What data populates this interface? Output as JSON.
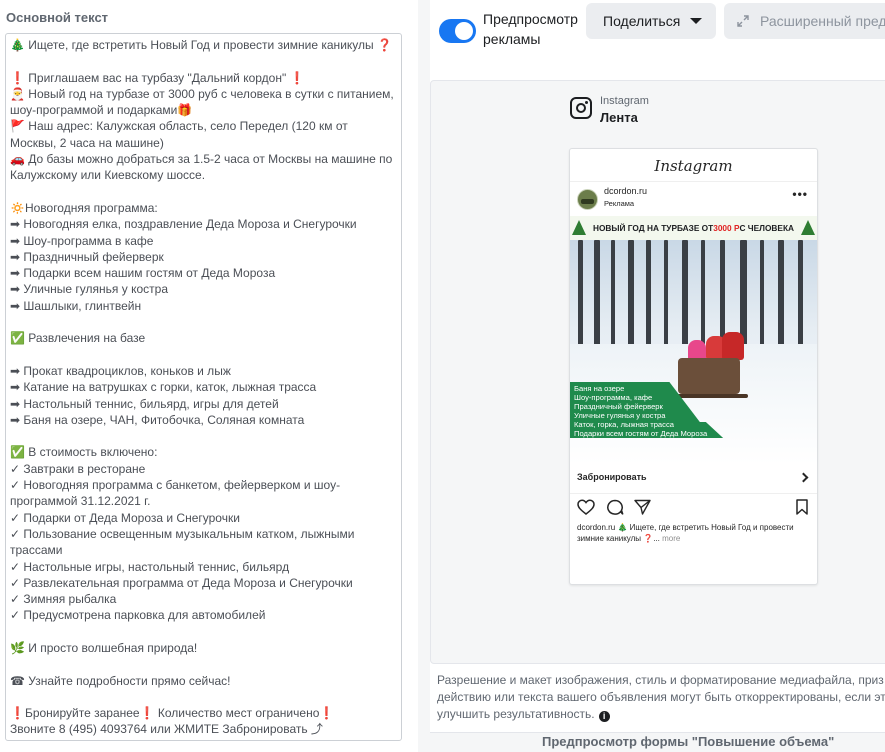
{
  "editor": {
    "title": "Основной текст",
    "body": "🎄 Ищете, где встретить Новый Год и провести зимние каникулы ❓\n\n❗ Приглашаем вас на турбазу \"Дальний кордон\" ❗\n🎅 Новый год на турбазе от 3000 руб с человека в сутки с питанием, шоу-программой и подарками🎁\n🚩 Наш адрес: Калужская область, село Передел (120 км от Москвы, 2 часа на машине)\n🚗 До базы можно добраться за 1.5-2 часа от Москвы на машине по Калужскому или Киевскому шоссе.\n\n🔅Новогодняя программа:\n➡ Новогодняя елка, поздравление Деда Мороза и Снегурочки\n➡ Шоу-программа в кафе\n➡ Праздничный фейерверк\n➡ Подарки всем нашим гостям от Деда Мороза\n➡ Уличные гулянья у костра\n➡ Шашлыки, глинтвейн\n\n✅ Развлечения на базе\n\n➡ Прокат квадроциклов, коньков и лыж\n➡ Катание на ватрушках с горки, каток, лыжная трасса\n➡ Настольный теннис, бильярд, игры для детей\n➡ Баня на озере, ЧАН, Фитобочка, Соляная комната\n\n✅ В стоимость включено:\n✓ Завтраки в ресторане\n✓ Новогодняя программа с банкетом, фейерверком и шоу-программой 31.12.2021 г.\n✓ Подарки от Деда Мороза и Снегурочки\n✓ Пользование освещенным музыкальным катком, лыжными трассами\n✓ Настольные игры, настольный теннис, бильярд\n✓ Развлекательная программа от Деда Мороза и Снегурочки\n✓ Зимняя рыбалка\n✓ Предусмотрена парковка для автомобилей\n\n🌿 И просто волшебная природа!\n\n☎ Узнайте подробности прямо сейчас!\n\n❗Бронируйте заранее❗ Количество мест ограничено❗\nЗвоните 8 (495) 4093764 или ЖМИТЕ Забронировать ⤴"
  },
  "toolbar": {
    "preview_toggle_label": "Предпросмотр рекламы",
    "preview_toggle_on": true,
    "share_label": "Поделиться",
    "advanced_label": "Расширенный пред"
  },
  "preview": {
    "platform": "Instagram",
    "placement": "Лента",
    "ig_wordmark": "Instagram",
    "account_name": "dcordon.ru",
    "sponsored_label": "Реклама",
    "creative_banner_pre": "НОВЫЙ ГОД НА ТУРБАЗЕ ОТ ",
    "creative_banner_price": "3000 Р",
    "creative_banner_post": " С ЧЕЛОВЕКА",
    "creative_list": "Баня на озере\nШоу-программа, кафе\nПраздничный фейерверк\nУличные гулянья у костра\nКаток, горка, лыжная трасса\nПодарки всем гостям от Деда Мороза",
    "cta_label": "Забронировать",
    "caption_account": "dcordon.ru",
    "caption_text": " 🎄 Ищете, где встретить Новый Год и провести зимние каникулы ❓...",
    "caption_more": " more"
  },
  "disclaimer": {
    "line1": "Разрешение и макет изображения, стиль и форматирование медиафайла, приз",
    "line2": "действию или текста вашего объявления могут быть откорректированы, если это",
    "line3": "улучшить результативность."
  },
  "bottom": {
    "title": "Предпросмотр формы \"Повышение объема\""
  },
  "colors": {
    "accent": "#1877f2",
    "button_bg": "#ebedf0",
    "panel_bg": "#f5f6f7",
    "creative_green": "#1f8a4c",
    "price_red": "#e02424"
  }
}
